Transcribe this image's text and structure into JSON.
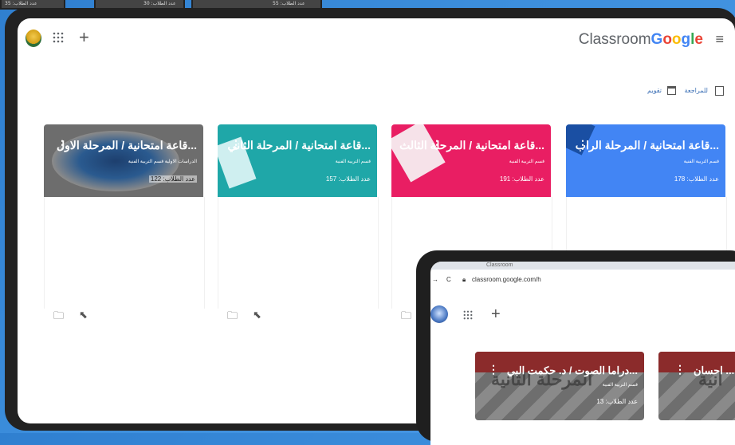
{
  "background_tiles": [
    {
      "text": "عدد الطلاب: 35"
    },
    {
      "text": "عدد الطلاب: 30"
    },
    {
      "text": "عدد الطلاب: 55"
    }
  ],
  "header": {
    "brand_classroom": "Classroom",
    "brand_google": "Google",
    "apps_icon": "apps-grid-icon",
    "add_icon": "plus-icon",
    "menu_icon": "hamburger-icon"
  },
  "toolbar": {
    "review_label": "للمراجعة",
    "calendar_label": "تقويم"
  },
  "cards": [
    {
      "title": "قاعة امتحانية / المرحلة الراب...",
      "subtitle": "قسم التربية الفنية",
      "students": "عدد الطلاب: 178",
      "color": "#4285f4"
    },
    {
      "title": "قاعة امتحانية / المرحلة الثالث...",
      "subtitle": "قسم التربية الفنية",
      "students": "عدد الطلاب: 191",
      "color": "#e91e63"
    },
    {
      "title": "قاعة امتحانية / المرحلة الثاني...",
      "subtitle": "قسم التربية الفنية",
      "students": "عدد الطلاب: 157",
      "color": "#1fa7a8"
    },
    {
      "title": "قاعة امتحانية / المرحلة الاول...",
      "subtitle": "الدراسات الاولية قسم التربية الفنية",
      "students": "عدد الطلاب: 122",
      "color": "#6d6d6d"
    }
  ],
  "tablet": {
    "tab_label": "Classroom",
    "url": "classroom.google.com/h",
    "cards": [
      {
        "title": "دراما الصوت / د. حكمت البي...",
        "subtitle": "قسم التربية الفنية",
        "students": "عدد الطلاب: 13",
        "banner": "المرحلة الثانية"
      },
      {
        "title": "احسان ...",
        "subtitle": "",
        "students": "",
        "banner": "انية"
      }
    ]
  }
}
